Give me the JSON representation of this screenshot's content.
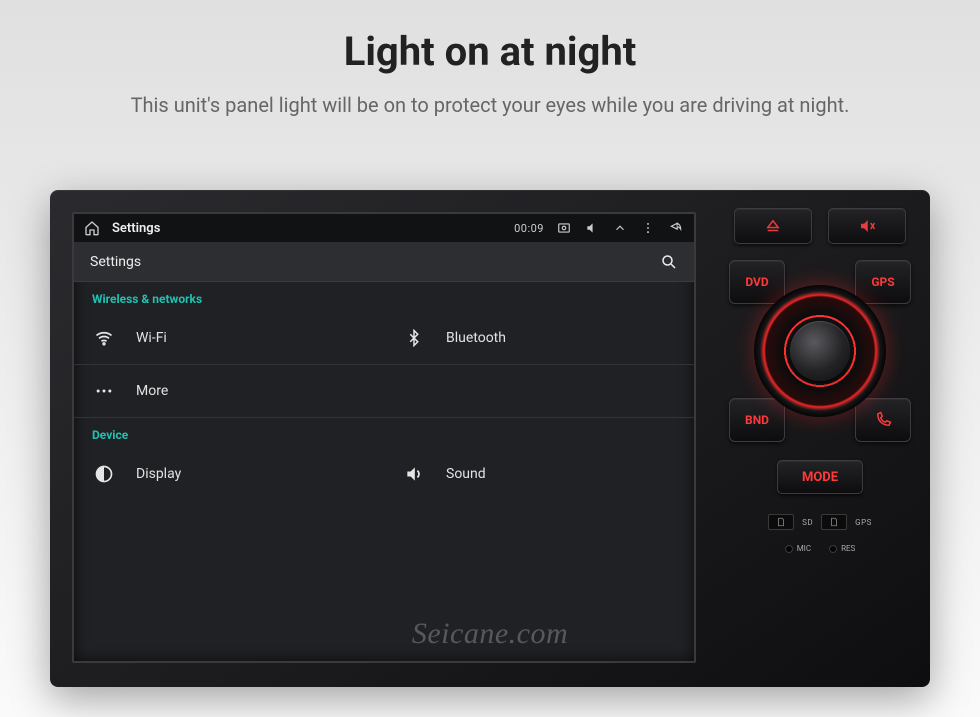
{
  "hero": {
    "title": "Light on at night",
    "subtitle": "This unit's panel light will be on to protect your eyes while you are driving at night."
  },
  "statusbar": {
    "title": "Settings",
    "time": "00:09"
  },
  "subheader": {
    "title": "Settings"
  },
  "sections": {
    "wireless_label": "Wireless & networks",
    "wifi": "Wi-Fi",
    "bluetooth": "Bluetooth",
    "more": "More",
    "device_label": "Device",
    "display": "Display",
    "sound": "Sound"
  },
  "hardware": {
    "corner_tl": "DVD",
    "corner_tr": "GPS",
    "corner_bl": "BND",
    "mode": "MODE",
    "slot_sd": "SD",
    "slot_gps": "GPS",
    "port_mic": "MIC",
    "port_res": "RES"
  },
  "watermark": "Seicane.com",
  "colors": {
    "accent_red": "#ff3a3a",
    "accent_teal": "#1fc2b2"
  }
}
